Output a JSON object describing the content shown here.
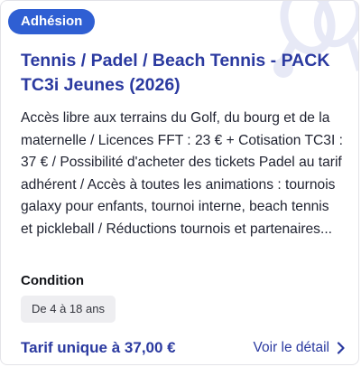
{
  "card": {
    "badge": "Adhésion",
    "title": "Tennis / Padel / Beach Tennis - PACK TC3i Jeunes (2026)",
    "description": "Accès libre aux terrains du Golf, du bourg et de la maternelle / Licences FFT : 23 € + Cotisation TC3I : 37 € / Possibilité d'acheter des tickets Padel au tarif adhérent / Accès à toutes les animations : tournois galaxy pour enfants, tournoi interne, beach tennis et pickleball / Réductions tournois et partenaires...",
    "condition_label": "Condition",
    "condition_value": "De 4 à 18 ans",
    "price": "Tarif unique à 37,00 €",
    "details_link": "Voir le détail"
  },
  "icons": {
    "background": "racket-ball-icon",
    "details": "chevron-right-icon"
  },
  "colors": {
    "accent": "#2f5fd3",
    "title_text": "#2b3aa0",
    "decoration": "#e7e9f6",
    "chip_background": "#eeeef1"
  }
}
